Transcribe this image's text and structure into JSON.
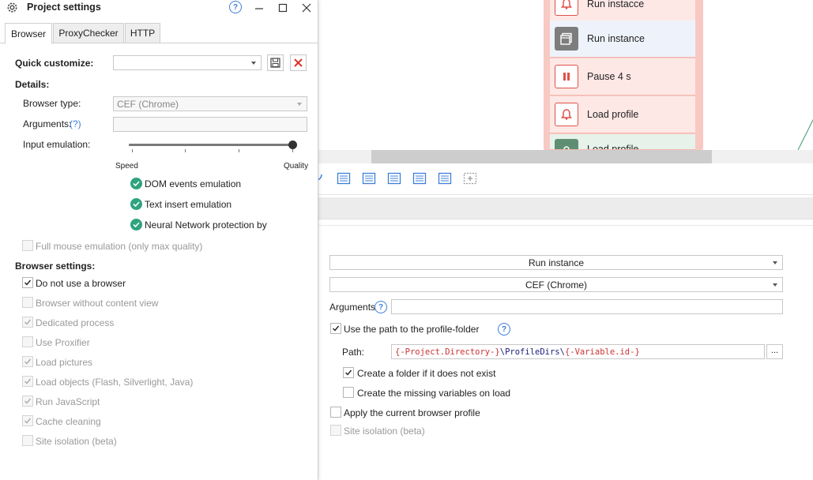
{
  "canvas": {
    "nodes": [
      {
        "label": "Run instacce",
        "icon": "bell-icon",
        "style": "red"
      },
      {
        "label": "Run instance",
        "icon": "window-icon",
        "style": "gray"
      },
      {
        "label": "Pause 4 s",
        "icon": "pause-icon",
        "style": "red"
      },
      {
        "label": "Load profile",
        "icon": "bell-icon",
        "style": "red"
      },
      {
        "label": "Load profile",
        "icon": "person-icon",
        "style": "green"
      }
    ]
  },
  "props": {
    "action_dropdown": "Run instance",
    "browser_dropdown": "CEF (Chrome)",
    "arguments_label": "Arguments",
    "use_path_label": "Use the path to the profile-folder",
    "path_label": "Path:",
    "path_parts": [
      "{-Project.Directory-}",
      "\\ProfileDirs\\",
      "{-Variable.id-}"
    ],
    "browse_label": "...",
    "create_folder_label": "Create a folder if it does not exist",
    "create_vars_label": "Create the missing variables on load",
    "apply_profile_label": "Apply the current browser profile",
    "site_isolation_label": "Site isolation (beta)"
  },
  "dialog": {
    "title": "Project settings",
    "tabs": [
      "Browser",
      "ProxyChecker",
      "HTTP"
    ],
    "quick_customize_label": "Quick customize:",
    "quick_customize_value": "",
    "details_label": "Details:",
    "browser_type_label": "Browser type:",
    "browser_type_value": "CEF (Chrome)",
    "arguments_label": "Arguments:",
    "arguments_help": "(?)",
    "arguments_value": "",
    "input_emulation_label": "Input emulation:",
    "slider_min_label": "Speed",
    "slider_max_label": "Quality",
    "slider_level": 1.0,
    "emulations": [
      "DOM events emulation",
      "Text insert emulation",
      "Neural Network protection bypas"
    ],
    "full_mouse_label": "Full mouse emulation (only max quality)",
    "browser_settings_label": "Browser settings:",
    "settings": [
      {
        "label": "Do not use a browser",
        "checked": true,
        "enabled": true
      },
      {
        "label": "Browser without content view",
        "checked": false,
        "enabled": false
      },
      {
        "label": "Dedicated process",
        "checked": true,
        "enabled": false
      },
      {
        "label": "Use Proxifier",
        "checked": false,
        "enabled": false
      },
      {
        "label": "Load pictures",
        "checked": true,
        "enabled": false
      },
      {
        "label": "Load objects (Flash, Silverlight, Java)",
        "checked": true,
        "enabled": false
      },
      {
        "label": "Run JavaScript",
        "checked": true,
        "enabled": false
      },
      {
        "label": "Cache cleaning",
        "checked": true,
        "enabled": false
      },
      {
        "label": "Site isolation (beta)",
        "checked": false,
        "enabled": false
      }
    ]
  },
  "colors": {
    "accent": "#3d7fd8",
    "ok": "#2ea37e",
    "danger": "#d9342b",
    "node_bg": "#f8c9c3"
  }
}
